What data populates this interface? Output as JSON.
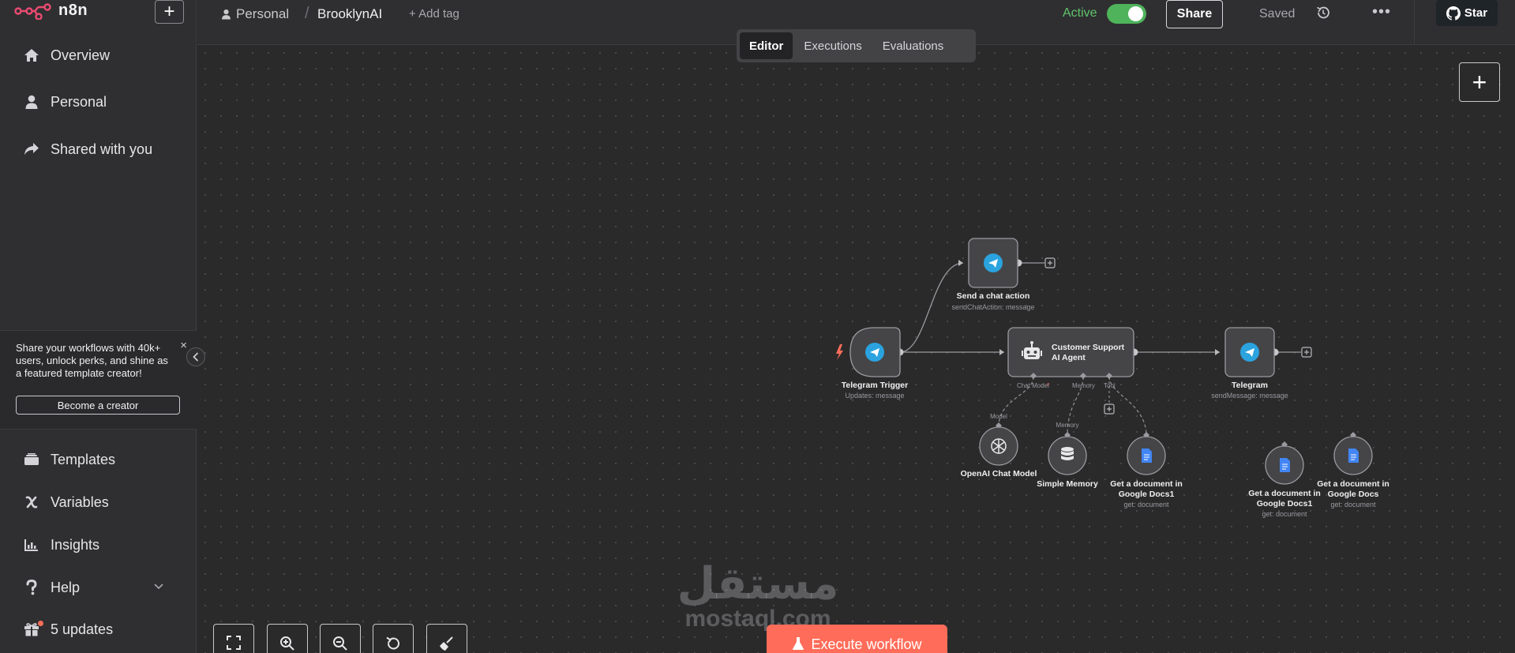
{
  "app": {
    "name": "n8n"
  },
  "sidebar": {
    "top_items": [
      {
        "label": "Overview",
        "icon": "home-icon"
      },
      {
        "label": "Personal",
        "icon": "user-icon"
      },
      {
        "label": "Shared with you",
        "icon": "share-icon"
      }
    ],
    "promo": {
      "text": "Share your workflows with 40k+ users, unlock perks, and shine as a featured template creator!",
      "button": "Become a creator",
      "close": "×"
    },
    "bottom_items": [
      {
        "label": "Templates",
        "icon": "templates-icon"
      },
      {
        "label": "Variables",
        "icon": "variables-icon"
      },
      {
        "label": "Insights",
        "icon": "chart-icon"
      },
      {
        "label": "Help",
        "icon": "help-icon"
      },
      {
        "label": "5 updates",
        "icon": "gift-icon"
      }
    ]
  },
  "header": {
    "project": "Personal",
    "workflow_name": "BrooklynAI",
    "add_tag": "+ Add tag",
    "active_label": "Active",
    "active": true,
    "share": "Share",
    "saved": "Saved",
    "more": "•••",
    "star": "Star"
  },
  "tabs": [
    {
      "label": "Editor",
      "active": true
    },
    {
      "label": "Executions",
      "active": false
    },
    {
      "label": "Evaluations",
      "active": false
    }
  ],
  "nodes": {
    "trigger": {
      "title": "Telegram Trigger",
      "sub": "Updates: message"
    },
    "send_action": {
      "title": "Send a chat action",
      "sub": "sendChatAction: message"
    },
    "agent": {
      "title_line1": "Customer Support",
      "title_line2": "AI Agent",
      "port_chat": "Chat Model",
      "port_required": "*",
      "port_memory": "Memory",
      "port_tool": "Tool"
    },
    "telegram": {
      "title": "Telegram",
      "sub": "sendMessage: message"
    },
    "openai": {
      "title": "OpenAI Chat Model",
      "port": "Model"
    },
    "memory": {
      "title": "Simple Memory",
      "port": "Memory"
    },
    "gdoc1": {
      "title_line1": "Get a document in",
      "title_line2": "Google Docs1",
      "sub": "get: document"
    },
    "gdoc1_b": {
      "title_line1": "Get a document in",
      "title_line2": "Google Docs1",
      "sub": "get: document"
    },
    "gdoc": {
      "title_line1": "Get a document in",
      "title_line2": "Google Docs",
      "sub": "get: document"
    }
  },
  "canvas": {
    "execute": "Execute workflow"
  },
  "watermark": {
    "arabic": "مستقل",
    "latin": "mostaql.com"
  },
  "colors": {
    "accent": "#ff6d5a",
    "active_green": "#5fc46b",
    "telegram": "#2aa3df",
    "gdocs": "#4285f4"
  }
}
